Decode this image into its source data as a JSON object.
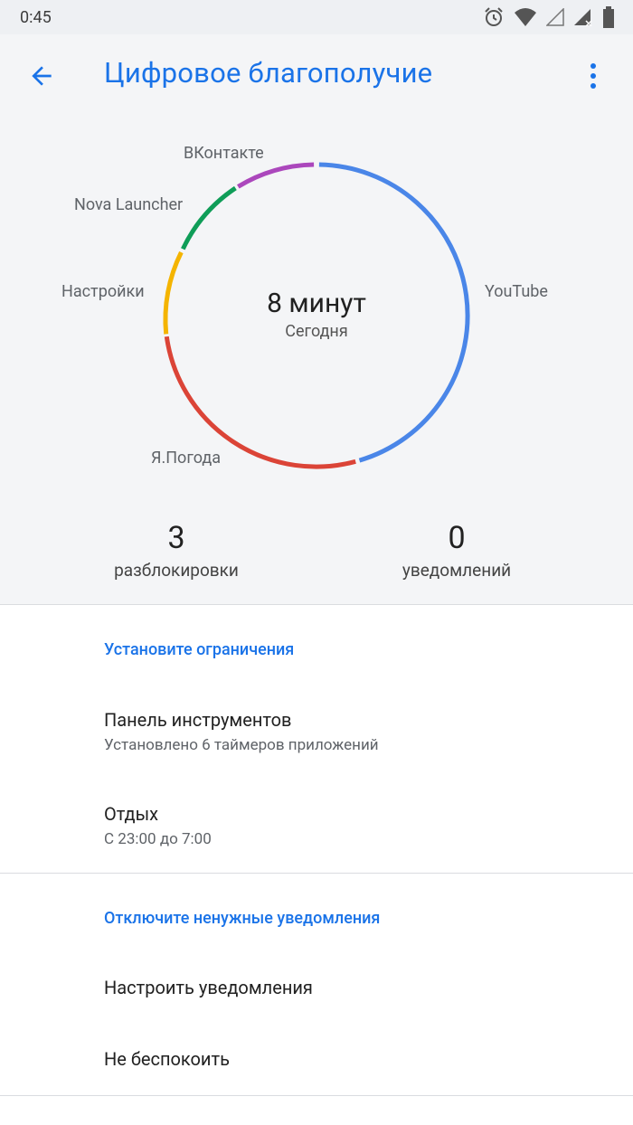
{
  "status_bar": {
    "time": "0:45",
    "icons": [
      "alarm-icon",
      "wifi-icon",
      "signal-empty-icon",
      "signal-no-data-icon",
      "battery-icon"
    ]
  },
  "app_bar": {
    "back_icon": "arrow-back-icon",
    "title": "Цифровое благополучие",
    "more_icon": "more-vert-icon"
  },
  "usage_chart": {
    "total_value": "8 минут",
    "total_label": "Сегодня",
    "segments": [
      {
        "app": "YouTube",
        "color": "#4a86e8"
      },
      {
        "app": "Я.Погода",
        "color": "#db4437"
      },
      {
        "app": "Настройки",
        "color": "#f4b400"
      },
      {
        "app": "Nova Launcher",
        "color": "#0f9d58"
      },
      {
        "app": "ВКонтакте",
        "color": "#ab47bc"
      }
    ]
  },
  "stats": {
    "unlocks_value": "3",
    "unlocks_label": "разблокировки",
    "notifications_value": "0",
    "notifications_label": "уведомлений"
  },
  "limits_section": {
    "header": "Установите ограничения",
    "dashboard_title": "Панель инструментов",
    "dashboard_subtitle": "Установлено 6 таймеров приложений",
    "winddown_title": "Отдых",
    "winddown_subtitle": "С 23:00 до 7:00"
  },
  "notifications_section": {
    "header": "Отключите ненужные уведомления",
    "manage_title": "Настроить уведомления",
    "dnd_title": "Не беспокоить"
  },
  "colors": {
    "accent": "#1a73e8",
    "top_background": "#f4f5f7"
  }
}
